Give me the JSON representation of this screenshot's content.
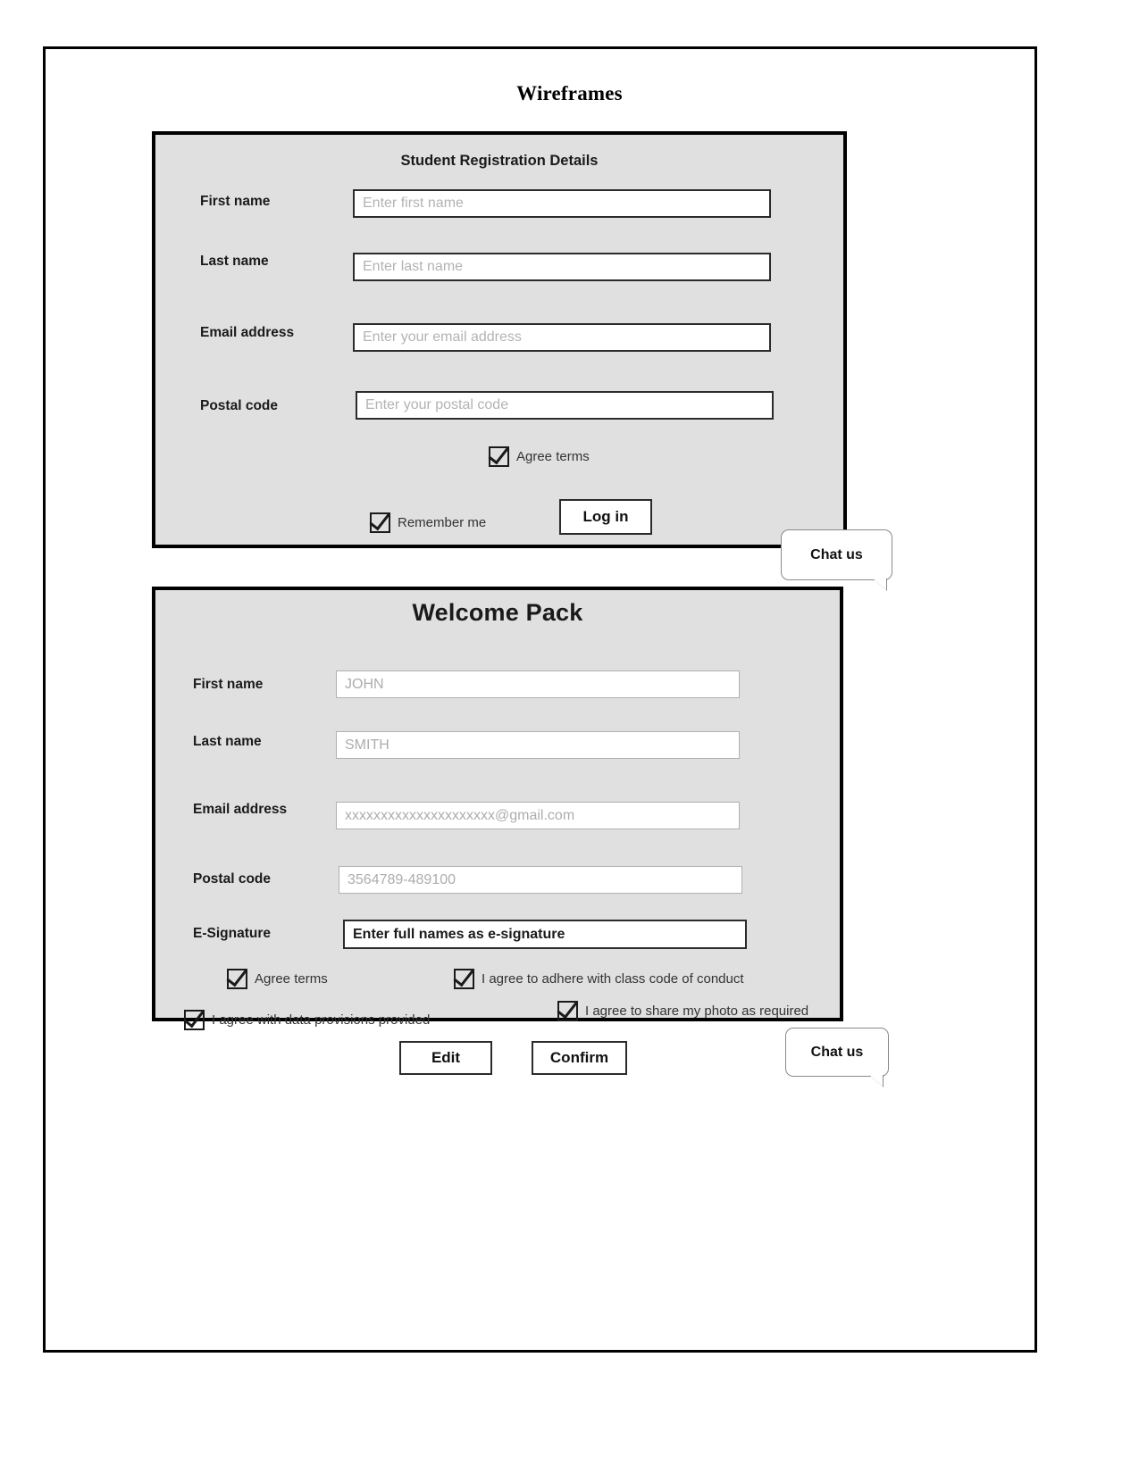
{
  "document": {
    "title": "Wireframes"
  },
  "registration_form": {
    "title": "Student Registration Details",
    "fields": [
      {
        "label": "First name",
        "placeholder": "Enter first name"
      },
      {
        "label": "Last name",
        "placeholder": "Enter last name"
      },
      {
        "label": "Email address",
        "placeholder": "Enter your email address"
      },
      {
        "label": "Postal code",
        "placeholder": "Enter your postal code"
      }
    ],
    "agree_terms_label": "Agree terms",
    "remember_me_label": "Remember me",
    "login_button": "Log in",
    "chat_bubble": "Chat us"
  },
  "welcome_pack": {
    "title": "Welcome Pack",
    "fields": [
      {
        "label": "First name",
        "value": "JOHN"
      },
      {
        "label": "Last name",
        "value": "SMITH"
      },
      {
        "label": "Email address",
        "value": "xxxxxxxxxxxxxxxxxxxxx@gmail.com"
      },
      {
        "label": "Postal code",
        "value": "3564789-489100"
      },
      {
        "label": "E-Signature",
        "value": "Enter full names as e-signature"
      }
    ],
    "checkboxes": [
      {
        "label": "Agree terms"
      },
      {
        "label": "I agree to adhere with class code of conduct"
      },
      {
        "label": "I agree with data provisions provided"
      },
      {
        "label": "I agree to share my photo as required"
      }
    ],
    "edit_button": "Edit",
    "confirm_button": "Confirm",
    "chat_bubble": "Chat us"
  },
  "colors": {
    "card_background": "#e0e0e0",
    "card_border": "#000000",
    "page_border": "#000000",
    "placeholder_text": "#b3b3b3",
    "label_text": "#1a1a1a"
  }
}
